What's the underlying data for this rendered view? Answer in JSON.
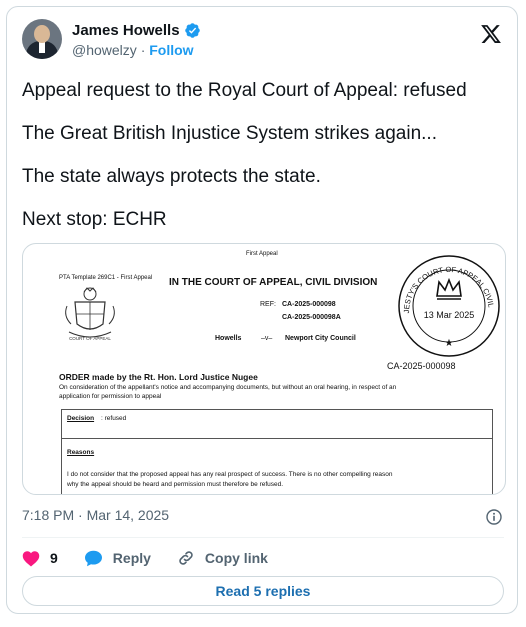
{
  "author": {
    "name": "James Howells",
    "handle": "@howelzy",
    "separator": "·",
    "follow_label": "Follow"
  },
  "tweet": {
    "lines": [
      "Appeal request to the Royal Court of Appeal: refused",
      "The Great British Injustice System strikes again...",
      "The state always protects the state.",
      "Next stop: ECHR"
    ]
  },
  "document": {
    "header_small": "First Appeal",
    "template": "PTA Template 269C1 - First Appeal",
    "court_title": "IN THE COURT OF APPEAL, CIVIL DIVISION",
    "ref_label": "REF:",
    "ref1": "CA-2025-000098",
    "ref2": "CA-2025-000098A",
    "party1": "Howells",
    "versus": "–v–",
    "party2": "Newport City Council",
    "stamp_text": "HER MAJESTY'S COURT OF APPEAL CIVIL DIVISION",
    "stamp_date": "13 Mar 2025",
    "stamp_ref": "CA-2025-000098",
    "crest_caption": "COURT OF APPEAL",
    "order_title": "ORDER made by the Rt. Hon. Lord Justice  Nugee",
    "order_line1": "On consideration of the appellant's notice and accompanying documents, but without an oral hearing, in respect of an",
    "order_line2": "application for permission to appeal",
    "decision_label": "Decision",
    "decision_value": ":  refused",
    "reasons_label": "Reasons",
    "reasons_line1": "I do not consider that the proposed appeal has any real prospect of success.  There is no other compelling reason",
    "reasons_line2": "why the appeal should be heard and permission must therefore be refused."
  },
  "meta": {
    "timestamp": "7:18 PM · Mar 14, 2025"
  },
  "actions": {
    "likes_count": "9",
    "reply_label": "Reply",
    "copy_link_label": "Copy link"
  },
  "read_replies_label": "Read 5 replies",
  "colors": {
    "accent": "#1d9bf0",
    "like": "#f91880",
    "text": "#0f1419",
    "muted": "#536471",
    "border": "#cfd9de"
  }
}
